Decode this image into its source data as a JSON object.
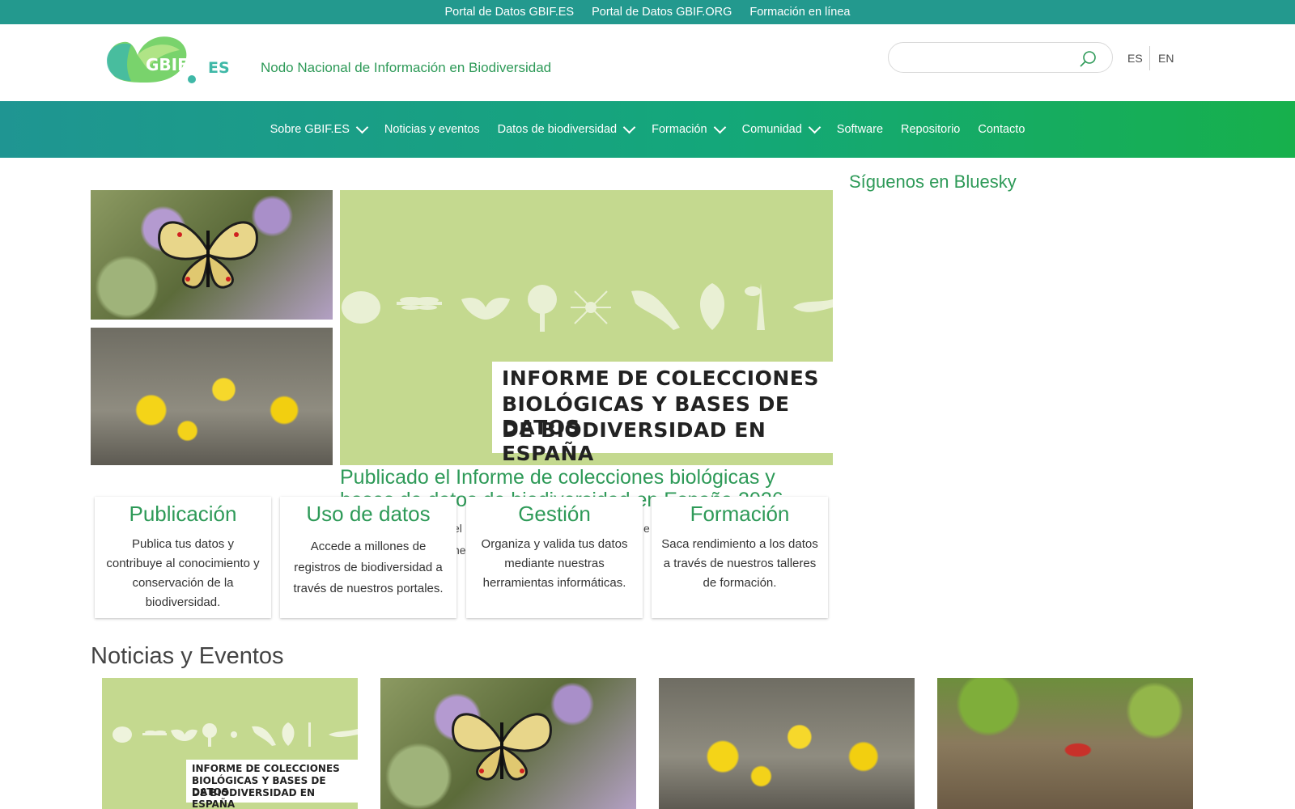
{
  "top_links": [
    "Portal de Datos GBIF.ES",
    "Portal de Datos GBIF.ORG",
    "Formación en línea"
  ],
  "header": {
    "logo_text": "GBIF.ES",
    "subtitle": "Nodo Nacional de Información en Biodiversidad",
    "search_placeholder": "",
    "lang_es": "ES",
    "lang_en": "EN"
  },
  "nav": [
    {
      "label": "Sobre GBIF.ES",
      "dropdown": true
    },
    {
      "label": "Noticias y eventos",
      "dropdown": false
    },
    {
      "label": "Datos de biodiversidad",
      "dropdown": true
    },
    {
      "label": "Formación",
      "dropdown": true
    },
    {
      "label": "Comunidad",
      "dropdown": true
    },
    {
      "label": "Software",
      "dropdown": false
    },
    {
      "label": "Repositorio",
      "dropdown": false
    },
    {
      "label": "Contacto",
      "dropdown": false
    }
  ],
  "hero": {
    "banner_lines": [
      "INFORME DE COLECCIONES",
      "BIOLÓGICAS Y BASES DE DATOS",
      "DE BIODIVERSIDAD EN ESPAÑA"
    ],
    "title": "Publicado el Informe de colecciones biológicas y bases de datos de biodiversidad en España 2026",
    "excerpt": "el                                                                                    e\nne                                                                                    ci"
  },
  "sidebar": {
    "follow": "Síguenos en Bluesky"
  },
  "cards": [
    {
      "title": "Publicación",
      "desc": "Publica tus datos y contribuye al conocimiento y conservación de la biodiversidad."
    },
    {
      "title": "Uso de datos",
      "desc": "Accede a millones de registros de biodiversidad a través de nuestros portales."
    },
    {
      "title": "Gestión",
      "desc": "Organiza y valida tus datos mediante nuestras herramientas informáticas."
    },
    {
      "title": "Formación",
      "desc": "Saca rendimiento a los datos a través de nuestros talleres de formación."
    }
  ],
  "news_section": {
    "title": "Noticias y Eventos"
  },
  "colors": {
    "topbar": "#23998e",
    "accent_green": "#2e9a58",
    "hero_bg": "#c4d98f"
  }
}
